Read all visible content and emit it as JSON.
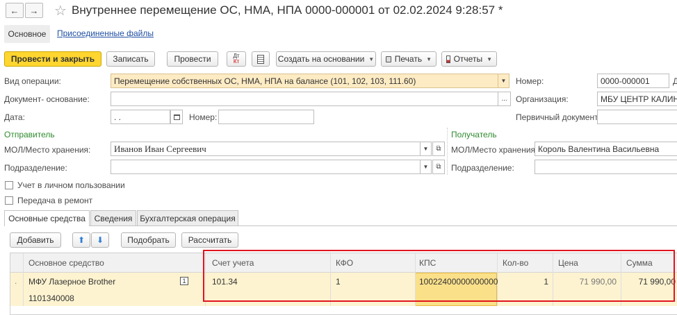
{
  "window": {
    "title": "Внутреннее перемещение ОС, НМА, НПА 0000-000001 от 02.02.2024 9:28:57 *"
  },
  "subtabs": {
    "main": "Основное",
    "files": "Присоединенные файлы"
  },
  "toolbar": {
    "post_close": "Провести и закрыть",
    "save": "Записать",
    "post": "Провести",
    "dtkt_top": "Дт",
    "dtkt_bottom": "Кт",
    "create_based": "Создать на основании",
    "print": "Печать",
    "reports": "Отчеты"
  },
  "form": {
    "op_type_label": "Вид операции:",
    "op_type_value": "Перемещение собственных ОС, НМА, НПА на балансе (101, 102, 103, 111.60)",
    "basis_label": "Документ- основание:",
    "basis_value": "",
    "date_label": "Дата:",
    "date_value": " .  .",
    "number2_label": "Номер:",
    "number2_value": "",
    "number_label": "Номер:",
    "number_value": "0000-000001",
    "number_suffix": "Д",
    "org_label": "Организация:",
    "org_value": "МБУ ЦЕНТР КАЛИНИ",
    "primary_doc_label": "Первичный документ:",
    "primary_doc_value": ""
  },
  "sender": {
    "heading": "Отправитель",
    "mol_label": "МОЛ/Место хранения:",
    "mol_value": "Иванов Иван Сергеевич",
    "dept_label": "Подразделение:",
    "dept_value": ""
  },
  "receiver": {
    "heading": "Получатель",
    "mol_label": "МОЛ/Место хранения:",
    "mol_value": "Король Валентина Васильевна",
    "dept_label": "Подразделение:",
    "dept_value": ""
  },
  "checkboxes": {
    "personal_use": "Учет в личном пользовании",
    "repair": "Передача в ремонт"
  },
  "tabs": {
    "fixed_assets": "Основные средства",
    "info": "Сведения",
    "accounting": "Бухгалтерская операция"
  },
  "table_toolbar": {
    "add": "Добавить",
    "pick": "Подобрать",
    "calc": "Рассчитать"
  },
  "table": {
    "columns": {
      "asset": "Основное средство",
      "account": "Счет учета",
      "kfo": "КФО",
      "kps": "КПС",
      "qty": "Кол-во",
      "price": "Цена",
      "sum": "Сумма"
    },
    "rows": [
      {
        "marker": ".",
        "asset": "МФУ Лазерное Brother",
        "asset_code": "1101340008",
        "badge": "1",
        "account": "101.34",
        "kfo": "1",
        "kps": "10022400000000000",
        "qty": "1",
        "price": "71 990,00",
        "sum": "71 990,00"
      }
    ]
  },
  "colors": {
    "primary_button": "#ffd62f",
    "selected_row": "#fdf3d0",
    "active_cell": "#fbe08a",
    "highlight_frame": "#e0141e",
    "section_heading": "#2e8b2e"
  }
}
